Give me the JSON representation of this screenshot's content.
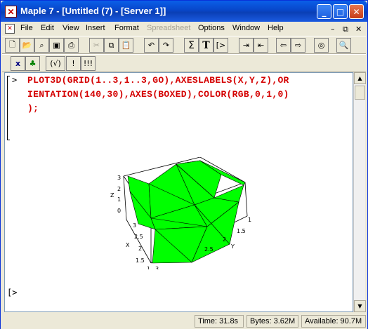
{
  "window": {
    "title": "Maple 7  - [Untitled (7) - [Server 1]]"
  },
  "menu": [
    "File",
    "Edit",
    "View",
    "Insert",
    "Format",
    "Spreadsheet",
    "Options",
    "Window",
    "Help"
  ],
  "toolbar_icons": [
    "new-icon",
    "open-icon",
    "open-url-icon",
    "save-icon",
    "print-icon",
    "cut-icon",
    "copy-icon",
    "paste-icon",
    "undo-icon",
    "redo-icon",
    "sigma-icon",
    "text-icon",
    "prompt-icon",
    "indent-icon",
    "outdent-icon",
    "back-icon",
    "forward-icon",
    "stop-icon",
    "zoom-icon"
  ],
  "toolbar2": {
    "b1": "x",
    "b2": "♣",
    "b3": "(√)",
    "b4": "!",
    "b5": "!!!"
  },
  "worksheet": {
    "prompt": ">",
    "input_lines": [
      "PLOT3D(GRID(1..3,1..3,GO),AXESLABELS(X,Y,Z),OR",
      "IENTATION(140,30),AXES(BOXED),COLOR(RGB,0,1,0)",
      ");"
    ],
    "empty_prompt": "[>"
  },
  "plot": {
    "zlabel": "Z",
    "xlabel": "X",
    "ylabel": "Y",
    "z_ticks": [
      "3",
      "2",
      "1",
      "0"
    ],
    "x_ticks": [
      "3",
      "2.5",
      "2",
      "1.5",
      "1"
    ],
    "y_ticks": [
      "1",
      "1.5",
      "2",
      "2.5",
      "3"
    ],
    "surface_color": "#00ff00"
  },
  "status": {
    "time": "Time:  31.8s",
    "bytes": "Bytes: 3.62M",
    "available": "Available: 90.7M"
  }
}
